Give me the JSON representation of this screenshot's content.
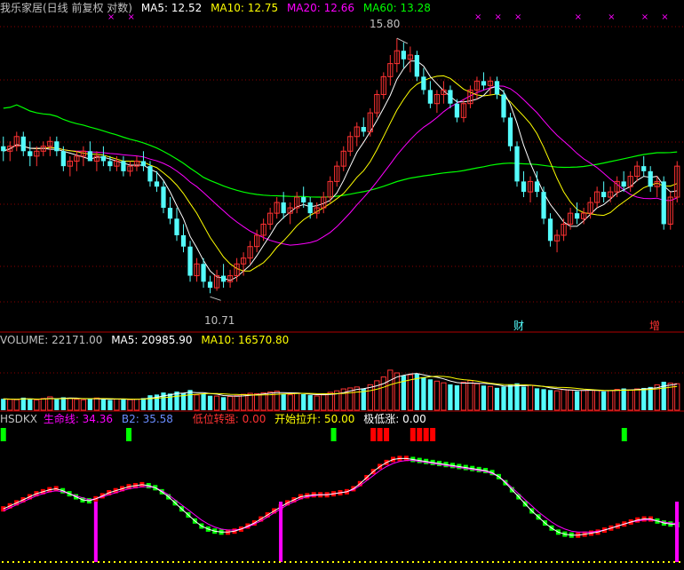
{
  "colors": {
    "background": "#000000",
    "up": "#ff3232",
    "down": "#54fcfc",
    "ma5": "#ffffff",
    "ma10": "#ffff00",
    "ma20": "#ff00ff",
    "ma60": "#00ff00",
    "grid": "#8b0000",
    "divider": "#b00000",
    "label": "#c0c0c0",
    "hsdkx_green": "#00ff00",
    "hsdkx_red": "#ff0000",
    "hsdkx_magenta": "#ff00ff",
    "hsdkx_yellow": "#ffff00"
  },
  "price_header": {
    "title": "我乐家居(日线 前复权 对数)",
    "ma5": "MA5: 12.52",
    "ma10": "MA10: 12.75",
    "ma20": "MA20: 12.66",
    "ma60": "MA60: 13.28"
  },
  "volume_header": {
    "label": "VOLUME: 22171.00",
    "ma5": "MA5: 20985.90",
    "ma10": "MA10: 16570.80"
  },
  "hsdkx_header": {
    "name": "HSDKX",
    "smx": "生命线: 34.36",
    "b2": "B2: 35.58",
    "dwzt": "低位转强: 0.00",
    "kslx": "开始拉升: 50.00",
    "jdz": "极低涨: 0.00"
  },
  "annotations": {
    "high": "15.80",
    "low": "10.71",
    "cai": "财",
    "zeng": "增"
  },
  "chart_data": {
    "type": "candlestick",
    "title": "我乐家居(日线 前复权 对数)",
    "y_scale": "log",
    "ylim": [
      10.4,
      16.3
    ],
    "high_marker": 15.8,
    "low_marker": 10.71,
    "grid": true,
    "ohlc": [
      [
        13.4,
        13.6,
        13.1,
        13.3
      ],
      [
        13.3,
        13.5,
        13.1,
        13.4
      ],
      [
        13.4,
        13.7,
        13.3,
        13.6
      ],
      [
        13.6,
        13.7,
        13.2,
        13.3
      ],
      [
        13.3,
        13.5,
        13.0,
        13.2
      ],
      [
        13.2,
        13.4,
        13.0,
        13.3
      ],
      [
        13.3,
        13.5,
        13.2,
        13.4
      ],
      [
        13.4,
        13.6,
        13.2,
        13.5
      ],
      [
        13.5,
        13.6,
        13.2,
        13.3
      ],
      [
        13.3,
        13.4,
        12.9,
        13.0
      ],
      [
        13.0,
        13.2,
        12.8,
        13.1
      ],
      [
        13.1,
        13.3,
        12.9,
        13.2
      ],
      [
        13.2,
        13.4,
        13.0,
        13.3
      ],
      [
        13.3,
        13.5,
        13.1,
        13.1
      ],
      [
        13.1,
        13.3,
        12.9,
        13.2
      ],
      [
        13.2,
        13.4,
        13.0,
        13.1
      ],
      [
        13.1,
        13.2,
        12.9,
        13.0
      ],
      [
        13.0,
        13.2,
        12.9,
        13.1
      ],
      [
        13.1,
        13.2,
        12.8,
        12.9
      ],
      [
        12.9,
        13.1,
        12.8,
        13.0
      ],
      [
        13.0,
        13.2,
        12.9,
        13.1
      ],
      [
        13.1,
        13.3,
        12.9,
        13.0
      ],
      [
        13.0,
        13.1,
        12.6,
        12.7
      ],
      [
        12.7,
        12.9,
        12.5,
        12.6
      ],
      [
        12.6,
        12.7,
        12.1,
        12.2
      ],
      [
        12.2,
        12.4,
        11.9,
        12.0
      ],
      [
        12.0,
        12.2,
        11.6,
        11.7
      ],
      [
        11.7,
        11.9,
        11.4,
        11.5
      ],
      [
        11.5,
        11.6,
        10.9,
        11.0
      ],
      [
        11.0,
        11.3,
        10.9,
        11.2
      ],
      [
        11.2,
        11.3,
        10.8,
        10.9
      ],
      [
        10.9,
        11.0,
        10.71,
        10.8
      ],
      [
        10.8,
        11.1,
        10.75,
        11.0
      ],
      [
        11.0,
        11.2,
        10.8,
        10.9
      ],
      [
        10.9,
        11.1,
        10.8,
        11.0
      ],
      [
        11.0,
        11.3,
        10.9,
        11.2
      ],
      [
        11.2,
        11.4,
        11.0,
        11.3
      ],
      [
        11.3,
        11.6,
        11.2,
        11.5
      ],
      [
        11.5,
        11.8,
        11.4,
        11.7
      ],
      [
        11.7,
        12.0,
        11.6,
        11.9
      ],
      [
        11.9,
        12.2,
        11.8,
        12.1
      ],
      [
        12.1,
        12.4,
        12.0,
        12.3
      ],
      [
        12.3,
        12.5,
        12.0,
        12.1
      ],
      [
        12.1,
        12.3,
        11.9,
        12.2
      ],
      [
        12.2,
        12.5,
        12.1,
        12.4
      ],
      [
        12.4,
        12.6,
        12.2,
        12.3
      ],
      [
        12.3,
        12.4,
        12.0,
        12.1
      ],
      [
        12.1,
        12.3,
        12.0,
        12.2
      ],
      [
        12.2,
        12.5,
        12.1,
        12.4
      ],
      [
        12.4,
        12.8,
        12.3,
        12.7
      ],
      [
        12.7,
        13.1,
        12.6,
        13.0
      ],
      [
        13.0,
        13.4,
        12.9,
        13.3
      ],
      [
        13.3,
        13.7,
        13.2,
        13.6
      ],
      [
        13.6,
        13.9,
        13.4,
        13.8
      ],
      [
        13.8,
        14.0,
        13.6,
        13.7
      ],
      [
        13.7,
        14.2,
        13.6,
        14.1
      ],
      [
        14.1,
        14.6,
        14.0,
        14.5
      ],
      [
        14.5,
        15.0,
        14.4,
        14.9
      ],
      [
        14.9,
        15.4,
        14.7,
        15.2
      ],
      [
        15.2,
        15.8,
        15.0,
        15.5
      ],
      [
        15.5,
        15.7,
        15.1,
        15.3
      ],
      [
        15.3,
        15.6,
        15.0,
        15.4
      ],
      [
        15.4,
        15.5,
        14.8,
        14.9
      ],
      [
        14.9,
        15.1,
        14.5,
        14.6
      ],
      [
        14.6,
        14.8,
        14.2,
        14.3
      ],
      [
        14.3,
        14.6,
        14.1,
        14.5
      ],
      [
        14.5,
        14.8,
        14.3,
        14.6
      ],
      [
        14.6,
        14.7,
        14.2,
        14.3
      ],
      [
        14.3,
        14.4,
        13.9,
        14.0
      ],
      [
        14.0,
        14.4,
        13.9,
        14.3
      ],
      [
        14.3,
        14.7,
        14.2,
        14.6
      ],
      [
        14.6,
        14.9,
        14.4,
        14.8
      ],
      [
        14.8,
        15.0,
        14.6,
        14.7
      ],
      [
        14.7,
        14.9,
        14.5,
        14.8
      ],
      [
        14.8,
        14.9,
        14.4,
        14.5
      ],
      [
        14.5,
        14.6,
        13.9,
        14.0
      ],
      [
        14.0,
        14.1,
        13.3,
        13.4
      ],
      [
        13.4,
        13.5,
        12.6,
        12.7
      ],
      [
        12.7,
        12.9,
        12.4,
        12.5
      ],
      [
        12.5,
        12.8,
        12.3,
        12.7
      ],
      [
        12.7,
        12.9,
        12.4,
        12.5
      ],
      [
        12.5,
        12.6,
        11.9,
        12.0
      ],
      [
        12.0,
        12.1,
        11.5,
        11.6
      ],
      [
        11.6,
        11.8,
        11.4,
        11.7
      ],
      [
        11.7,
        12.0,
        11.6,
        11.9
      ],
      [
        11.9,
        12.2,
        11.8,
        12.1
      ],
      [
        12.1,
        12.3,
        11.9,
        12.0
      ],
      [
        12.0,
        12.2,
        11.9,
        12.1
      ],
      [
        12.1,
        12.4,
        12.0,
        12.3
      ],
      [
        12.3,
        12.6,
        12.2,
        12.5
      ],
      [
        12.5,
        12.7,
        12.3,
        12.4
      ],
      [
        12.4,
        12.6,
        12.3,
        12.5
      ],
      [
        12.5,
        12.8,
        12.4,
        12.7
      ],
      [
        12.7,
        12.9,
        12.5,
        12.6
      ],
      [
        12.6,
        12.9,
        12.5,
        12.8
      ],
      [
        12.8,
        13.1,
        12.7,
        13.0
      ],
      [
        13.0,
        13.2,
        12.8,
        12.9
      ],
      [
        12.9,
        13.0,
        12.5,
        12.6
      ],
      [
        12.6,
        12.8,
        12.4,
        12.7
      ],
      [
        12.7,
        12.8,
        11.8,
        11.9
      ],
      [
        11.9,
        12.5,
        11.8,
        12.4
      ],
      [
        12.4,
        13.1,
        12.3,
        13.0
      ]
    ],
    "volume": [
      9500,
      9000,
      8800,
      10500,
      9200,
      8600,
      9800,
      11200,
      9400,
      10800,
      9900,
      9100,
      8700,
      9600,
      10200,
      8900,
      8500,
      9300,
      9700,
      8800,
      9200,
      10100,
      12500,
      13100,
      14800,
      13900,
      15600,
      14200,
      16900,
      12800,
      13600,
      12100,
      11800,
      10900,
      11500,
      12200,
      13300,
      14100,
      13800,
      14600,
      15200,
      15900,
      13700,
      12900,
      14300,
      13400,
      12600,
      11900,
      12800,
      14900,
      16200,
      17800,
      18600,
      19400,
      18100,
      21300,
      24600,
      27800,
      33500,
      31200,
      28900,
      29600,
      30400,
      27600,
      25800,
      24300,
      22900,
      21600,
      20800,
      23400,
      24800,
      22100,
      20600,
      19900,
      18700,
      19800,
      21300,
      22500,
      19700,
      20900,
      18300,
      17600,
      16900,
      16200,
      17300,
      16800,
      15900,
      16400,
      17100,
      16600,
      15700,
      16300,
      17400,
      18200,
      16900,
      17800,
      18600,
      19400,
      21200,
      23800,
      22600,
      22171
    ],
    "volume_ylim": [
      0,
      52000
    ],
    "hsdkx": {
      "smx": [
        50,
        53,
        56,
        59,
        62,
        65,
        67,
        69,
        70,
        68,
        65,
        62,
        59,
        58,
        60,
        63,
        66,
        68,
        70,
        72,
        73,
        74,
        73,
        71,
        67,
        62,
        56,
        50,
        44,
        38,
        33,
        30,
        28,
        27,
        27,
        28,
        30,
        33,
        36,
        40,
        44,
        48,
        52,
        56,
        59,
        62,
        63,
        64,
        64,
        64,
        65,
        66,
        67,
        70,
        75,
        81,
        87,
        92,
        96,
        99,
        100,
        100,
        99,
        98,
        97,
        96,
        95,
        94,
        93,
        92,
        91,
        90,
        89,
        88,
        86,
        82,
        76,
        69,
        62,
        55,
        48,
        42,
        36,
        31,
        27,
        25,
        24,
        24,
        25,
        26,
        27,
        29,
        31,
        33,
        35,
        37,
        39,
        40,
        40,
        38,
        36,
        35,
        34.36
      ],
      "b2": [
        48,
        51,
        54,
        57,
        60,
        63,
        65,
        67,
        68,
        67,
        65,
        63,
        61,
        59,
        60,
        62,
        64,
        66,
        68,
        70,
        71,
        72,
        72,
        71,
        68,
        64,
        59,
        54,
        49,
        44,
        39,
        35,
        32,
        30,
        29,
        29,
        30,
        32,
        35,
        38,
        42,
        46,
        50,
        54,
        57,
        60,
        62,
        63,
        64,
        64,
        65,
        66,
        67,
        69,
        73,
        78,
        83,
        88,
        92,
        95,
        97,
        98,
        98,
        97,
        96,
        95,
        94,
        93,
        92,
        91,
        90,
        89,
        88,
        87,
        85,
        82,
        77,
        71,
        65,
        59,
        53,
        47,
        42,
        37,
        33,
        30,
        28,
        27,
        27,
        27,
        28,
        29,
        31,
        33,
        35,
        37,
        38,
        39,
        39,
        38,
        37,
        36,
        35.58
      ],
      "dwzt_bars": [
        0,
        0,
        0,
        0,
        0,
        0,
        0,
        0,
        0,
        0,
        0,
        0,
        0,
        0,
        0,
        0,
        0,
        0,
        0,
        0,
        0,
        0,
        0,
        0,
        0,
        0,
        0,
        0,
        0,
        0,
        0,
        1,
        0,
        0,
        0,
        0,
        0,
        0,
        0,
        0,
        0,
        0,
        0,
        0,
        0,
        0,
        0,
        0,
        0,
        0,
        0,
        0,
        0,
        0,
        0,
        0,
        0,
        0,
        0,
        0,
        0,
        0,
        0,
        0,
        0,
        0,
        0,
        0,
        0,
        0,
        0,
        0,
        0,
        0,
        0,
        0,
        0,
        0,
        0,
        0,
        0,
        0,
        0,
        0,
        0,
        0,
        0,
        0,
        0,
        0,
        0,
        0,
        0,
        0,
        0,
        0,
        0,
        0,
        0,
        0,
        0,
        0,
        0,
        0
      ],
      "buy_signal_index": [
        0,
        19,
        50,
        94
      ],
      "kslx_index": [
        56,
        57,
        58,
        62,
        63,
        64,
        65
      ],
      "spike_index": [
        14,
        42,
        105,
        124
      ],
      "hsdkx_ylim": [
        0,
        110
      ]
    }
  }
}
